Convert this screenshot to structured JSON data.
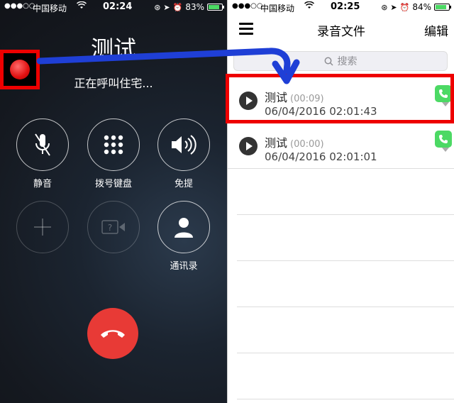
{
  "left_status_bar": {
    "signal": "●●●○○",
    "carrier": "中国移动",
    "time": "02:24",
    "battery": "83%",
    "battery_level": 0.83
  },
  "call": {
    "name": "测试",
    "status": "正在呼叫住宅...",
    "buttons": [
      {
        "label": "静音",
        "icon": "mic-off-icon"
      },
      {
        "label": "拨号键盘",
        "icon": "keypad-icon"
      },
      {
        "label": "免提",
        "icon": "speaker-icon"
      },
      {
        "label": "",
        "icon": "add-call-icon"
      },
      {
        "label": "",
        "icon": "facetime-icon"
      },
      {
        "label": "通讯录",
        "icon": "contacts-icon"
      }
    ]
  },
  "right_status_bar": {
    "signal": "●●●○○",
    "carrier": "中国移动",
    "time": "02:25",
    "battery": "84%",
    "battery_level": 0.84
  },
  "recordings": {
    "title": "录音文件",
    "edit_label": "编辑",
    "search_placeholder": "搜索",
    "items": [
      {
        "name": "测试",
        "duration": "(00:09)",
        "date": "06/04/2016 02:01:43"
      },
      {
        "name": "测试",
        "duration": "(00:00)",
        "date": "06/04/2016 02:01:01"
      }
    ]
  },
  "colors": {
    "highlight": "#ee0000",
    "arrow": "#1f3fd6",
    "end_call": "#e83a36",
    "phone_green": "#4cd964"
  }
}
